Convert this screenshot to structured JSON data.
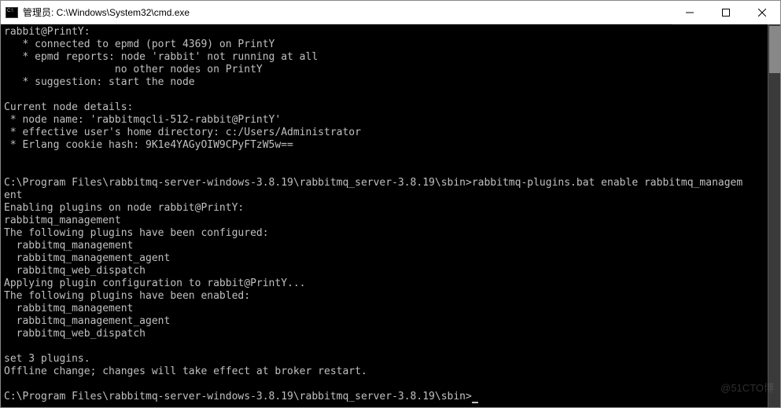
{
  "titlebar": {
    "title": "管理员: C:\\Windows\\System32\\cmd.exe"
  },
  "terminal": {
    "line1": "rabbit@PrintY:",
    "line2": "   * connected to epmd (port 4369) on PrintY",
    "line3": "   * epmd reports: node 'rabbit' not running at all",
    "line4": "                  no other nodes on PrintY",
    "line5": "   * suggestion: start the node",
    "line6": "",
    "line7": "Current node details:",
    "line8": " * node name: 'rabbitmqcli-512-rabbit@PrintY'",
    "line9": " * effective user's home directory: c:/Users/Administrator",
    "line10": " * Erlang cookie hash: 9K1e4YAGyOIW9CPyFTzW5w==",
    "line11": "",
    "line12": "",
    "line13": "C:\\Program Files\\rabbitmq-server-windows-3.8.19\\rabbitmq_server-3.8.19\\sbin>rabbitmq-plugins.bat enable rabbitmq_managem",
    "line14": "ent",
    "line15": "Enabling plugins on node rabbit@PrintY:",
    "line16": "rabbitmq_management",
    "line17": "The following plugins have been configured:",
    "line18": "  rabbitmq_management",
    "line19": "  rabbitmq_management_agent",
    "line20": "  rabbitmq_web_dispatch",
    "line21": "Applying plugin configuration to rabbit@PrintY...",
    "line22": "The following plugins have been enabled:",
    "line23": "  rabbitmq_management",
    "line24": "  rabbitmq_management_agent",
    "line25": "  rabbitmq_web_dispatch",
    "line26": "",
    "line27": "set 3 plugins.",
    "line28": "Offline change; changes will take effect at broker restart.",
    "line29": "",
    "line30": "C:\\Program Files\\rabbitmq-server-windows-3.8.19\\rabbitmq_server-3.8.19\\sbin>"
  },
  "watermark": "@51CTO博"
}
